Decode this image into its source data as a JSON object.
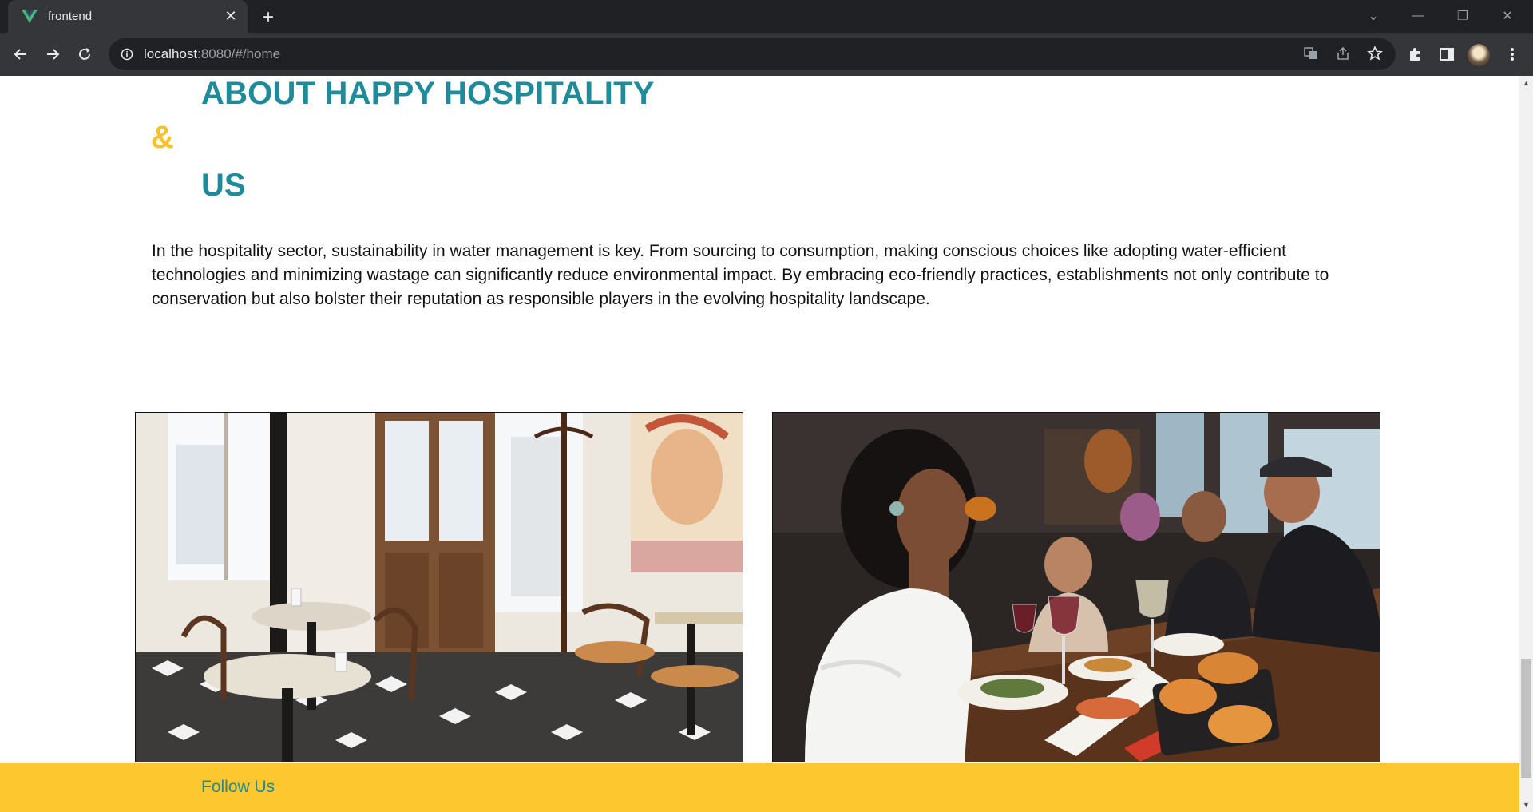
{
  "browser": {
    "tab_title": "frontend",
    "tab_close": "✕",
    "new_tab": "+",
    "url_host": "localhost",
    "url_rest": ":8080/#/home",
    "window_controls": {
      "dropdown": "⌄",
      "minimize": "—",
      "restore": "❐",
      "close": "✕"
    }
  },
  "page": {
    "heading_line1": "ABOUT HAPPY HOSPITALITY",
    "heading_amp": "&",
    "heading_line2": "US",
    "about_text": "In the hospitality sector, sustainability in water management is key. From sourcing to consumption, making conscious choices like adopting water-efficient technologies and minimizing wastage can significantly reduce environmental impact. By embracing eco-friendly practices, establishments not only contribute to conservation but also bolster their reputation as responsible players in the evolving hospitality landscape.",
    "footer_label": "Follow Us"
  },
  "colors": {
    "teal": "#1f8a99",
    "yellow": "#fdc82f",
    "amp_yellow": "#f5c22e"
  }
}
